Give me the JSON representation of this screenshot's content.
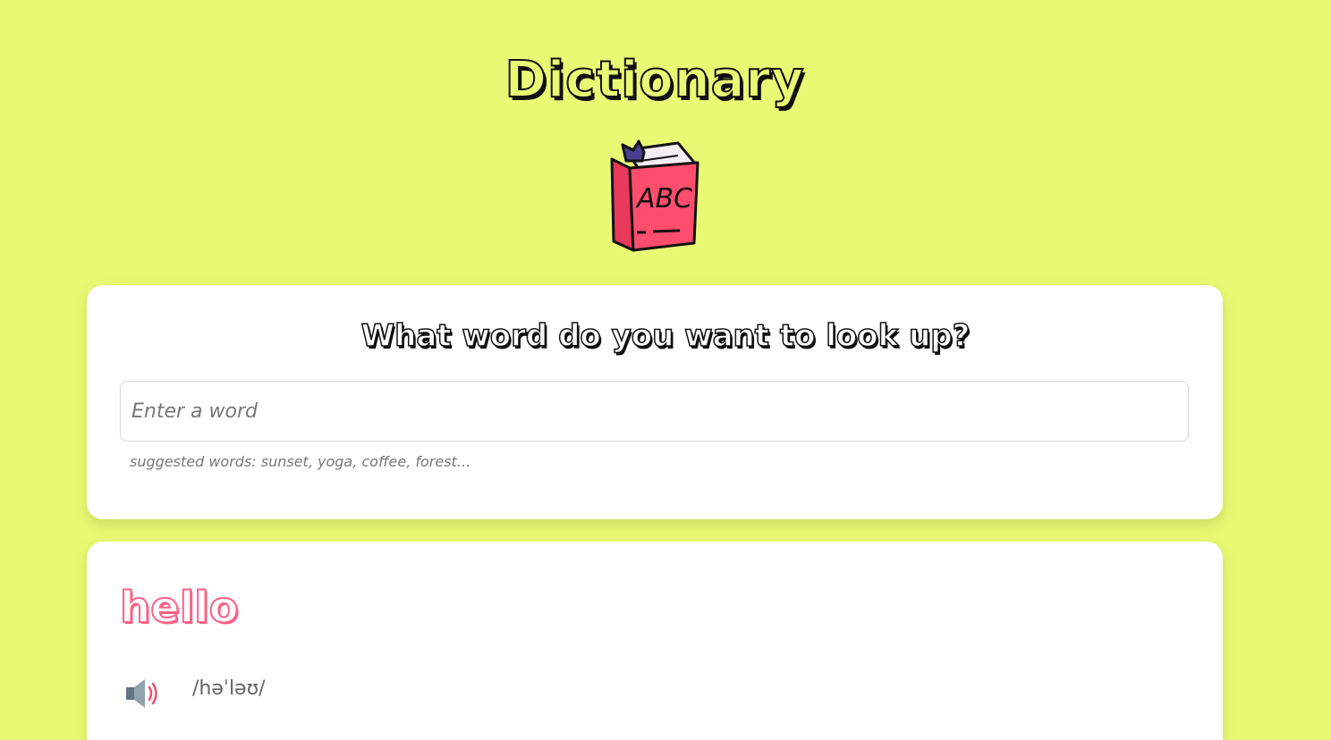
{
  "header": {
    "title": "Dictionary",
    "logo_text": "ABC",
    "logo_icon": "book-icon"
  },
  "search": {
    "heading": "What word do you want to look up?",
    "placeholder": "Enter a word",
    "value": "",
    "suggestions_text": "suggested words: sunset, yoga, coffee, forest..."
  },
  "result": {
    "word": "hello",
    "phonetic": "/həˈləʊ/",
    "audio_icon": "speaker-icon"
  },
  "colors": {
    "background": "#e8fa74",
    "accent": "#ff5f86",
    "book": "#ff4d6d",
    "bookmark": "#4a3f8f"
  }
}
